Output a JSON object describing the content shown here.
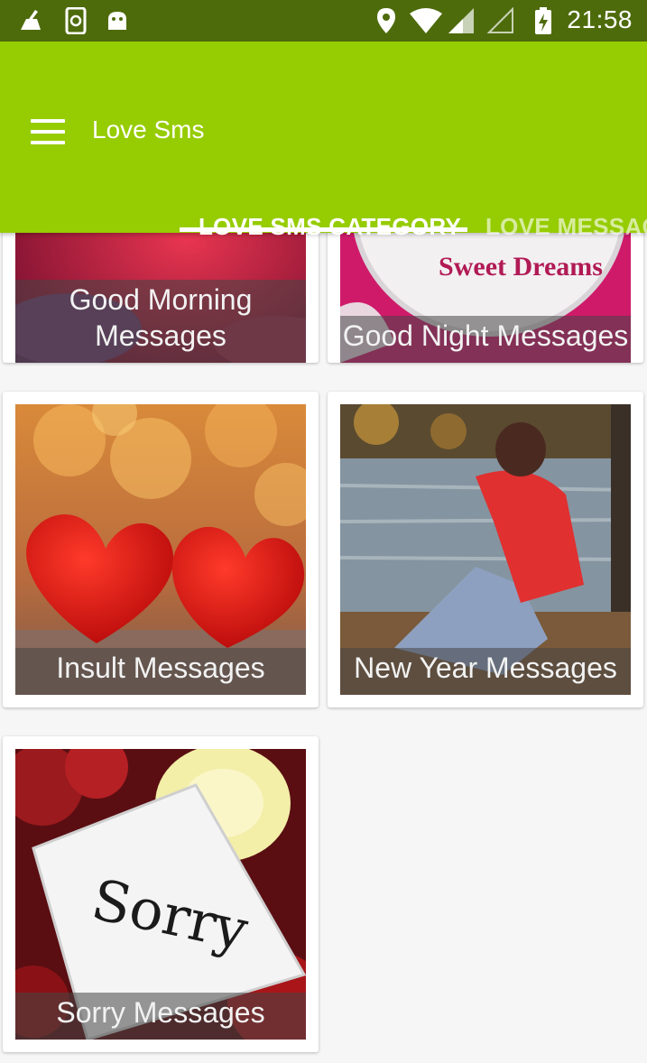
{
  "status_bar": {
    "time": "21:58",
    "icons": [
      "cleaner-icon",
      "sync-phone-icon",
      "android-icon",
      "location-icon",
      "wifi-icon",
      "signal-icon",
      "signal-empty-icon",
      "battery-charging-icon"
    ]
  },
  "app_bar": {
    "title": "Love Sms",
    "menu_icon": "hamburger-menu-icon",
    "tabs": [
      {
        "label": "LOVE SMS CATEGORY",
        "active": true
      },
      {
        "label": "LOVE MESSAG",
        "active": false
      }
    ]
  },
  "categories": [
    {
      "caption": "Good Morning Messages"
    },
    {
      "caption": "Good Night Messages",
      "image_text": "Sweet Dreams"
    },
    {
      "caption": "Insult Messages"
    },
    {
      "caption": "New Year Messages"
    },
    {
      "caption": "Sorry Messages",
      "image_text": "Sorry"
    }
  ],
  "colors": {
    "status_bar": "#4e6b0c",
    "app_bar": "#96cc02",
    "background": "#f6f6f6",
    "card": "#ffffff"
  }
}
